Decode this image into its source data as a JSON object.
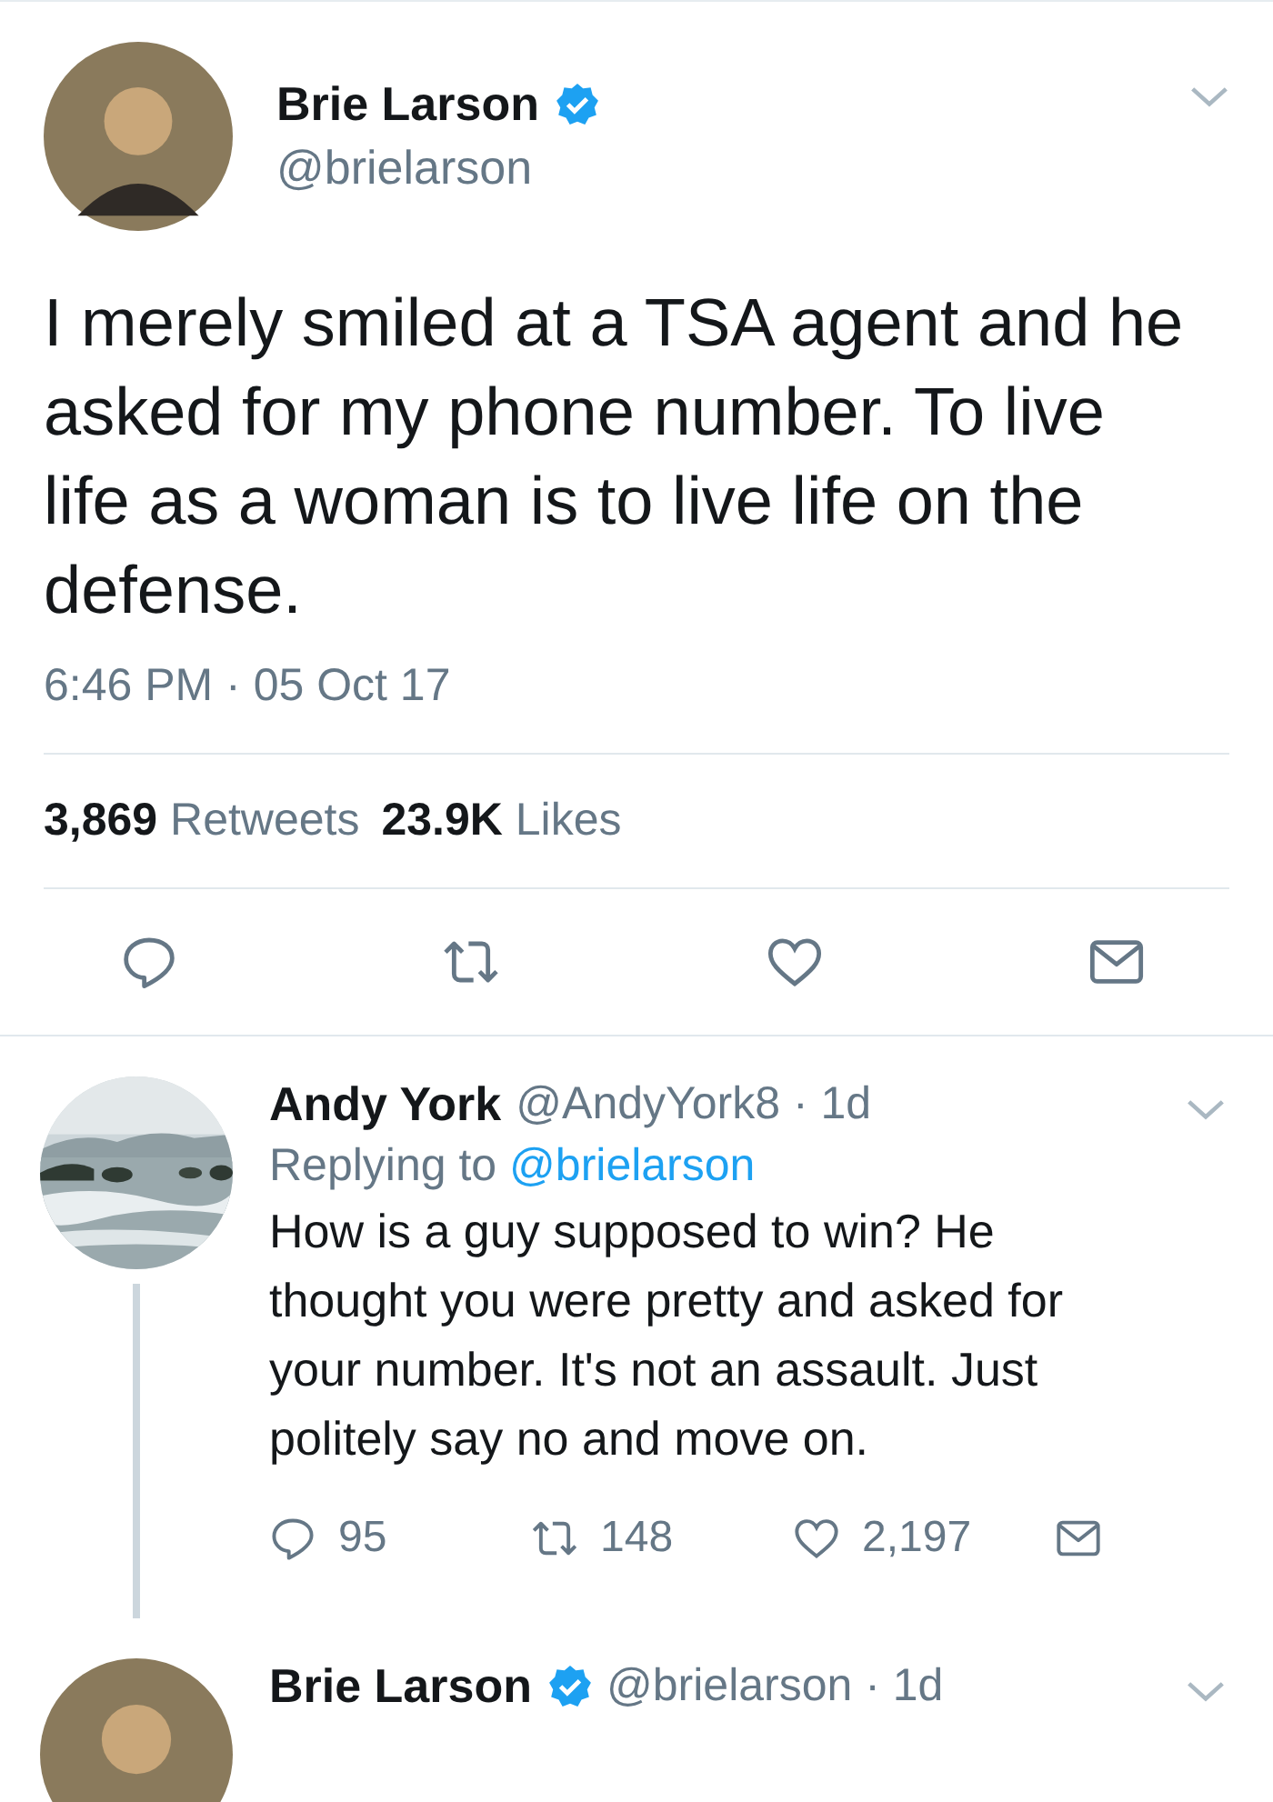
{
  "tweet": {
    "author": {
      "name": "Brie Larson",
      "verified": true,
      "handle": "@brielarson"
    },
    "text": "I merely smiled at a TSA agent and he asked for my phone number. To live life as a woman is to live life on the defense.",
    "timestamp": "6:46 PM · 05 Oct 17",
    "stats": [
      {
        "count": "3,869",
        "label": "Retweets"
      },
      {
        "count": "23.9K",
        "label": "Likes"
      }
    ],
    "actions": [
      {
        "kind": "reply"
      },
      {
        "kind": "retweet"
      },
      {
        "kind": "like"
      },
      {
        "kind": "message"
      }
    ]
  },
  "replies": [
    {
      "name": "Andy York",
      "verified": false,
      "meta": "@AndyYork8 · 1d",
      "thread_line": true,
      "replying_prefix": "Replying to",
      "replying_handle": "@brielarson",
      "text": "How is a guy supposed to win? He thought you were pretty and asked for your number. It's not an assault. Just politely say no and move on.",
      "actions": [
        {
          "kind": "reply",
          "count": "95"
        },
        {
          "kind": "retweet",
          "count": "148"
        },
        {
          "kind": "like",
          "count": "2,197"
        },
        {
          "kind": "message"
        }
      ]
    },
    {
      "avatar": {
        "kind": "person"
      },
      "name": "Brie Larson",
      "verified": true,
      "meta": "@brielarson · 1d"
    }
  ]
}
